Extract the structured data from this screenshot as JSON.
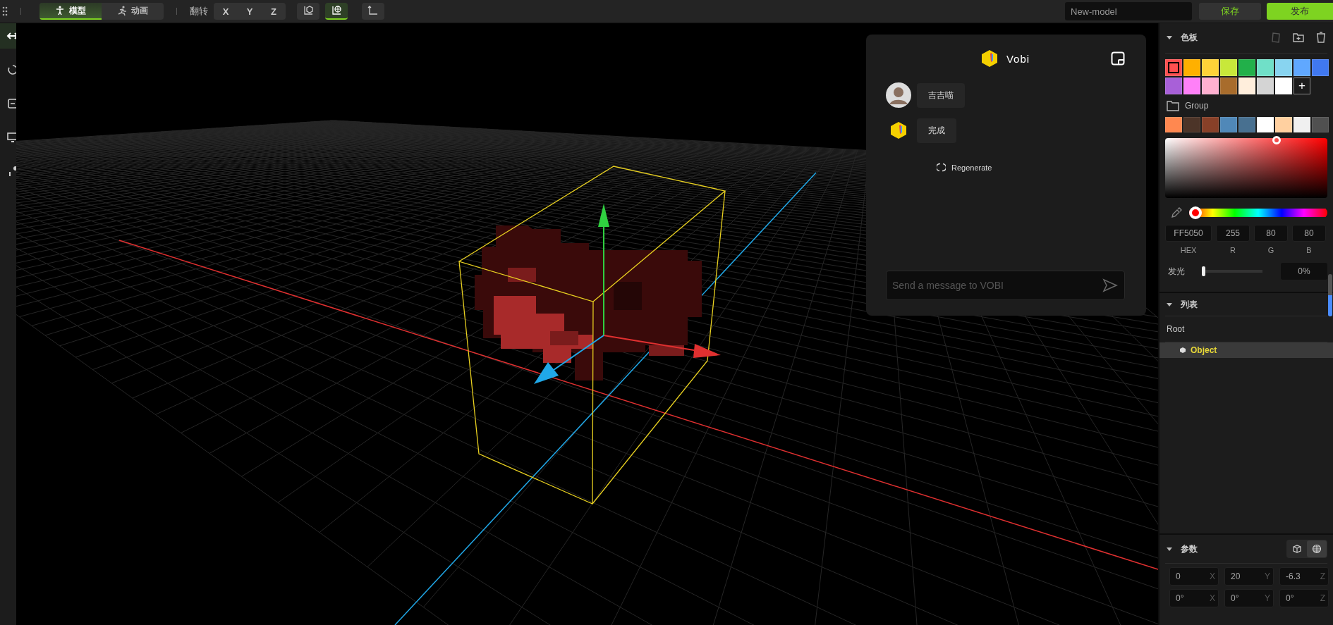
{
  "toolbar": {
    "mode_tabs": [
      {
        "label": "模型",
        "selected": true
      },
      {
        "label": "动画",
        "selected": false
      }
    ],
    "flip_label": "翻转",
    "axes": [
      "X",
      "Y",
      "Z"
    ],
    "view_buttons": [
      {
        "selected": false
      },
      {
        "selected": true
      }
    ],
    "model_name": "New-model",
    "save": "保存",
    "publish": "发布"
  },
  "left_tools": [
    {
      "selected": true
    },
    {
      "selected": false
    },
    {
      "selected": false
    },
    {
      "selected": false
    },
    {
      "selected": false
    }
  ],
  "chat": {
    "title": "Vobi",
    "messages": [
      {
        "kind": "user",
        "text": "吉吉喵"
      },
      {
        "kind": "bot",
        "text": "完成"
      }
    ],
    "regenerate": "Regenerate",
    "placeholder": "Send a message to VOBI"
  },
  "palette": {
    "title": "色板",
    "swatches": [
      {
        "color": "#ff5050",
        "selected": true
      },
      {
        "color": "#ffb000",
        "selected": false
      },
      {
        "color": "#ffd338",
        "selected": false
      },
      {
        "color": "#c8e83a",
        "selected": false
      },
      {
        "color": "#22b04a",
        "selected": false
      },
      {
        "color": "#70e0c8",
        "selected": false
      },
      {
        "color": "#88d4f0",
        "selected": false
      },
      {
        "color": "#60a8ff",
        "selected": false
      },
      {
        "color": "#4078f0",
        "selected": false
      },
      {
        "color": "#a860d8",
        "selected": false
      },
      {
        "color": "#ff80f8",
        "selected": false
      },
      {
        "color": "#ffb0d0",
        "selected": false
      },
      {
        "color": "#a86c2c",
        "selected": false
      },
      {
        "color": "#ffeedc",
        "selected": false
      },
      {
        "color": "#d4d4d4",
        "selected": false
      },
      {
        "color": "#ffffff",
        "selected": false
      }
    ],
    "add": "+",
    "group_label": "Group",
    "group_swatches": [
      {
        "color": "#ff8850"
      },
      {
        "color": "#4c3428"
      },
      {
        "color": "#884028"
      },
      {
        "color": "#5088b8"
      },
      {
        "color": "#487090"
      },
      {
        "color": "#ffffff"
      },
      {
        "color": "#ffd0a0"
      },
      {
        "color": "#f0f0f0"
      },
      {
        "color": "#505050"
      }
    ],
    "hue": {
      "level": 0
    },
    "fields": [
      {
        "value": "FF5050",
        "label": "HEX"
      },
      {
        "value": "255",
        "label": "R"
      },
      {
        "value": "80",
        "label": "G"
      },
      {
        "value": "80",
        "label": "B"
      }
    ],
    "glow_label": "发光",
    "glow": {
      "level": 0
    },
    "glow_reading": "0%"
  },
  "list": {
    "title": "列表",
    "tree": [
      {
        "label": "Root",
        "selected": false,
        "children": [
          {
            "label": "Object",
            "selected": true
          }
        ]
      }
    ]
  },
  "params": {
    "title": "参数",
    "space_buttons": [
      {
        "selected": false
      },
      {
        "selected": true
      }
    ],
    "rows": [
      [
        {
          "value": "0",
          "axis": "X"
        },
        {
          "value": "20",
          "axis": "Y"
        },
        {
          "value": "-6.3",
          "axis": "Z"
        }
      ],
      [
        {
          "value": "0°",
          "axis": "X"
        },
        {
          "value": "0°",
          "axis": "Y"
        },
        {
          "value": "0°",
          "axis": "Z"
        }
      ]
    ]
  }
}
